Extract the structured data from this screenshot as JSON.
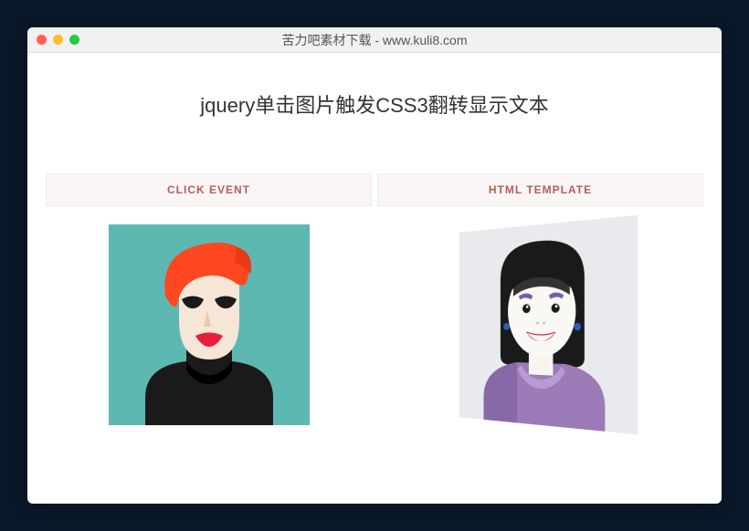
{
  "window": {
    "title": "苦力吧素材下载 - www.kuli8.com"
  },
  "page": {
    "heading": "jquery单击图片触发CSS3翻转显示文本"
  },
  "cards": [
    {
      "label": "CLICK EVENT",
      "icon": "avatar-red-hair"
    },
    {
      "label": "HTML TEMPLATE",
      "icon": "avatar-black-hair"
    }
  ]
}
